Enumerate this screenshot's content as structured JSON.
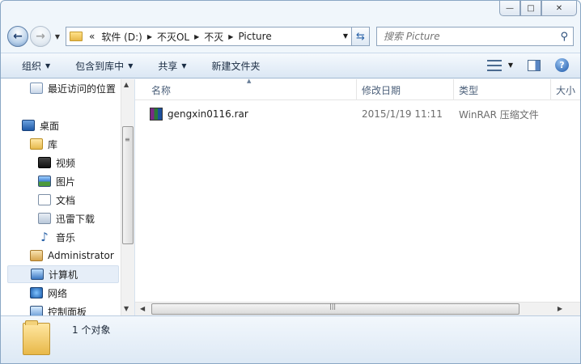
{
  "window": {
    "caption": {
      "minimize": "—",
      "maximize": "□",
      "close": "✕"
    }
  },
  "address": {
    "overflow": "«",
    "crumbs": [
      "软件 (D:)",
      "不灭OL",
      "不灭",
      "Picture"
    ],
    "search_placeholder": "搜索 Picture"
  },
  "toolbar": {
    "organize": "组织",
    "include_in_library": "包含到库中",
    "share": "共享",
    "new_folder": "新建文件夹"
  },
  "nav": {
    "items": [
      {
        "label": "最近访问的位置",
        "icon": "recent-places-icon"
      },
      {
        "label": "桌面",
        "icon": "desktop-icon"
      },
      {
        "label": "库",
        "icon": "library-icon"
      },
      {
        "label": "视频",
        "icon": "video-icon"
      },
      {
        "label": "图片",
        "icon": "picture-icon"
      },
      {
        "label": "文档",
        "icon": "document-icon"
      },
      {
        "label": "迅雷下载",
        "icon": "xunlei-icon"
      },
      {
        "label": "音乐",
        "icon": "music-icon"
      },
      {
        "label": "Administrator",
        "icon": "user-icon"
      },
      {
        "label": "计算机",
        "icon": "computer-icon"
      },
      {
        "label": "网络",
        "icon": "network-icon"
      },
      {
        "label": "控制面板",
        "icon": "control-panel-icon"
      }
    ],
    "selected": "计算机"
  },
  "columns": {
    "name": "名称",
    "date": "修改日期",
    "type": "类型",
    "size": "大小"
  },
  "files": [
    {
      "name": "gengxin0116.rar",
      "date": "2015/1/19 11:11",
      "type": "WinRAR 压缩文件",
      "icon": "rar-archive-icon"
    }
  ],
  "status": {
    "count_text": "1 个对象"
  }
}
